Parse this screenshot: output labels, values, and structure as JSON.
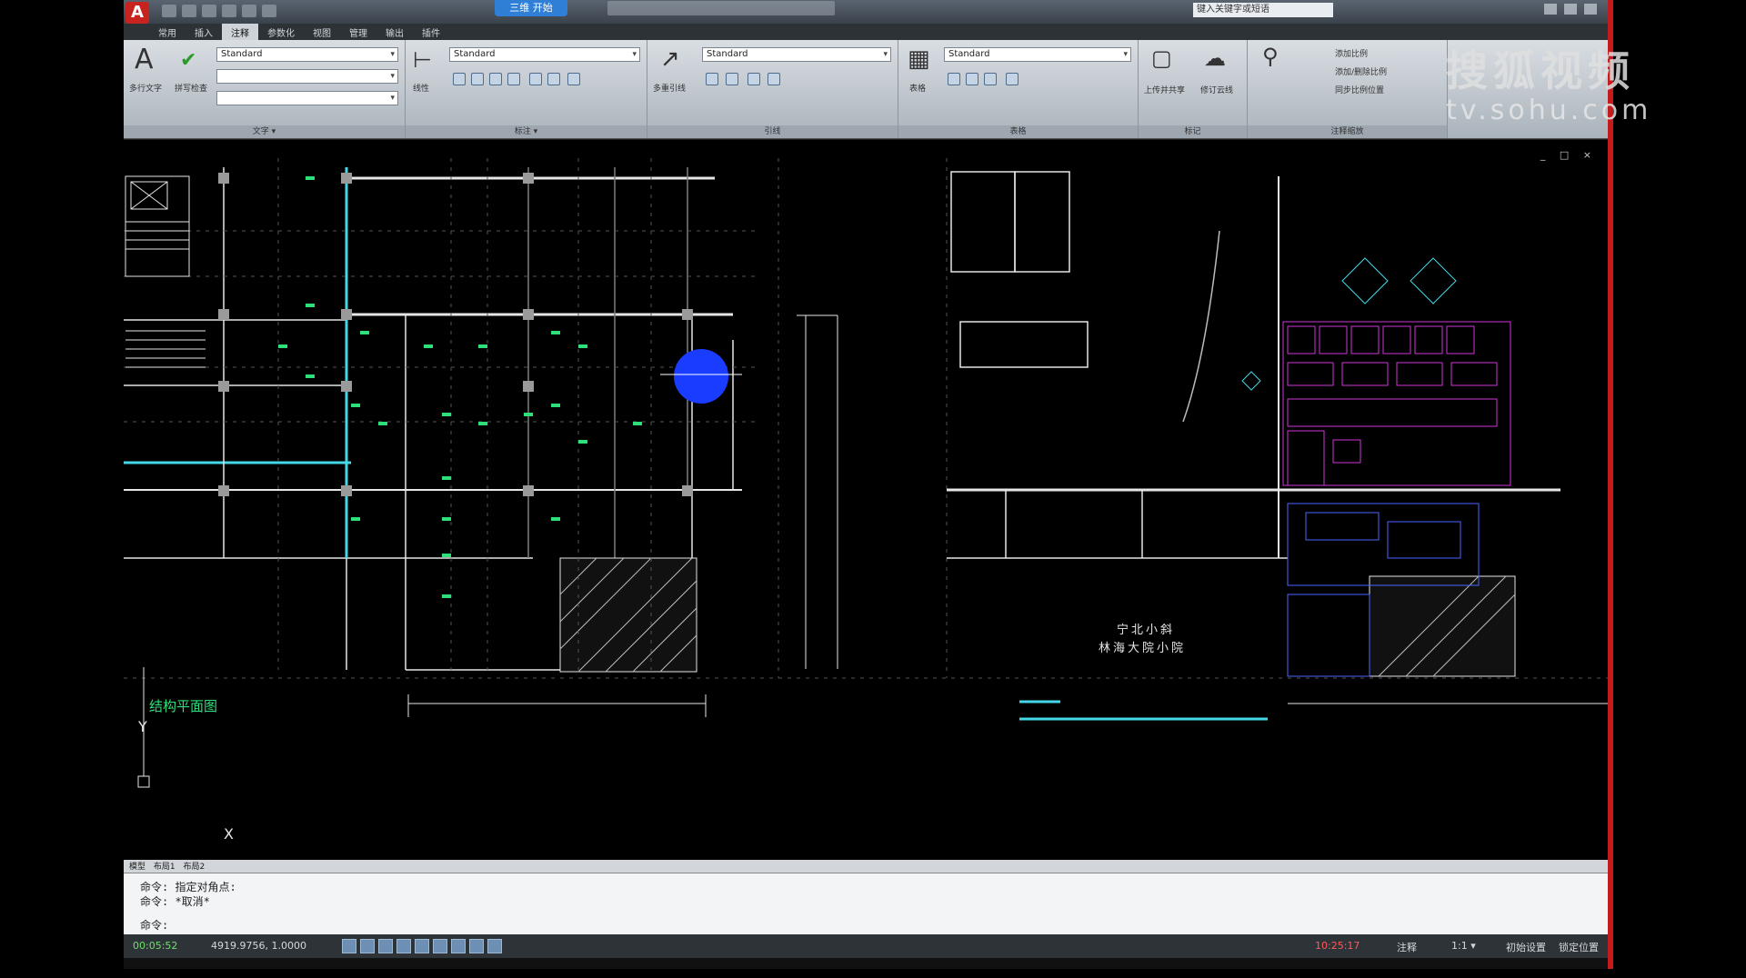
{
  "app": {
    "logo_letter": "A",
    "title_badge": "三维 开始",
    "window_title_left": "",
    "window_title_right": "",
    "search_placeholder": "键入关键字或短语"
  },
  "tabs": [
    "常用",
    "插入",
    "注释",
    "参数化",
    "视图",
    "管理",
    "输出",
    "插件"
  ],
  "ribbon": {
    "text_panel": {
      "label": "文字 ▾",
      "style": "Standard",
      "big_icon": "A",
      "big_label": "多行文字",
      "check_label": "拼写检查"
    },
    "dim_panel": {
      "label": "标注 ▾",
      "style": "Standard",
      "big_label": "线性"
    },
    "leader_panel": {
      "label": "引线",
      "style": "Standard",
      "big_label": "多重引线"
    },
    "table_panel": {
      "label": "表格",
      "style": "Standard",
      "big_label": "表格"
    },
    "markup_panel": {
      "label": "标记",
      "b1": "上传并共享",
      "b2": "修订云线"
    },
    "scale_panel": {
      "label": "注释缩放",
      "items": [
        "添加比例",
        "添加/删除比例",
        "同步比例位置"
      ]
    }
  },
  "drawing": {
    "left_title": "结构平面图",
    "center_text_1": "宁北小斜",
    "center_text_2": "林海大院小院",
    "ucs_y": "Y",
    "ucs_x": "X",
    "viewport_ctrls": "_ □ ×"
  },
  "layout_tabs": [
    "模型",
    "布局1",
    "布局2"
  ],
  "command_lines": [
    "命令: 指定对角点:",
    "命令: *取消*",
    "命令:"
  ],
  "status": {
    "coords": "00:05:52",
    "scale": "4919.9756, 1.0000",
    "time": "10:25:17",
    "right_items": [
      "注释",
      "1:1 ▾",
      "初始设置",
      "锁定位置"
    ]
  },
  "watermark": {
    "cn": "搜狐视频",
    "url": "tv.sohu.com"
  },
  "colors": {
    "cyan": "#45d7e8",
    "green": "#2de07a",
    "white": "#e6e6e6",
    "magenta": "#d033d8",
    "blue_select": "#1a3cff",
    "grey": "#7d7d7d"
  }
}
